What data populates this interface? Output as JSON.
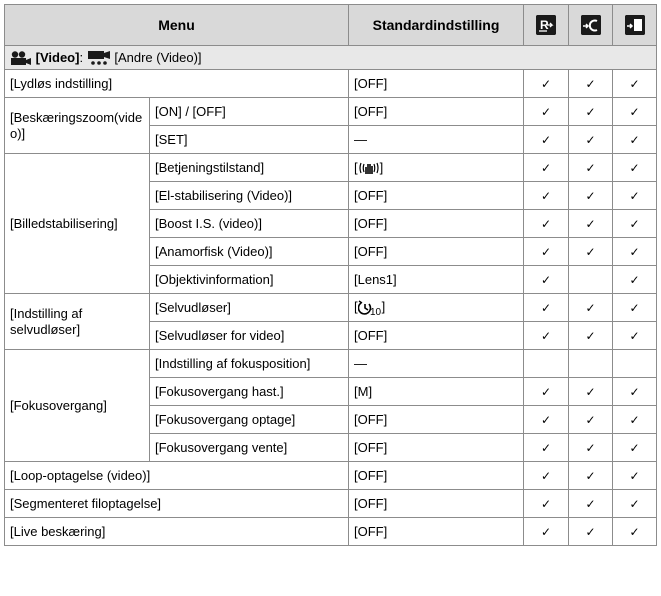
{
  "header": {
    "menu": "Menu",
    "default": "Standardindstilling",
    "col_icons": [
      "reset-icon",
      "custom-save-icon",
      "copy-settings-icon"
    ]
  },
  "section": {
    "video_label": "[Video]",
    "separator": ":",
    "sub_label": "[Andre (Video)]"
  },
  "check": "✓",
  "rows": {
    "lydlos": {
      "name": "[Lydløs indstilling]",
      "default": "[OFF]"
    },
    "beskaring": {
      "name": "[Beskæringszoom(video)]",
      "sub1": "[ON] / [OFF]",
      "default1": "[OFF]",
      "sub2": "[SET]",
      "default2": "—"
    },
    "billedstab": {
      "name": "[Billedstabilisering]",
      "sub1": "[Betjeningstilstand]",
      "default1_pre": "[",
      "default1_post": "]",
      "sub2": "[El-stabilisering (Video)]",
      "default2": "[OFF]",
      "sub3": "[Boost I.S. (video)]",
      "default3": "[OFF]",
      "sub4": "[Anamorfisk (Video)]",
      "default4": "[OFF]",
      "sub5": "[Objektivinformation]",
      "default5": "[Lens1]"
    },
    "selvudloser": {
      "name": "[Indstilling af selvudløser]",
      "sub1": "[Selvudløser]",
      "default1_pre": "[",
      "default1_post": "]",
      "sub2": "[Selvudløser for video]",
      "default2": "[OFF]"
    },
    "fokus": {
      "name": "[Fokusovergang]",
      "sub1": "[Indstilling af fokusposition]",
      "default1": "—",
      "sub2": "[Fokusovergang hast.]",
      "default2": "[M]",
      "sub3": "[Fokusovergang optage]",
      "default3": "[OFF]",
      "sub4": "[Fokusovergang vente]",
      "default4": "[OFF]"
    },
    "loop": {
      "name": "[Loop-optagelse (video)]",
      "default": "[OFF]"
    },
    "segment": {
      "name": "[Segmenteret filoptagelse]",
      "default": "[OFF]"
    },
    "live": {
      "name": "[Live beskæring]",
      "default": "[OFF]"
    }
  }
}
